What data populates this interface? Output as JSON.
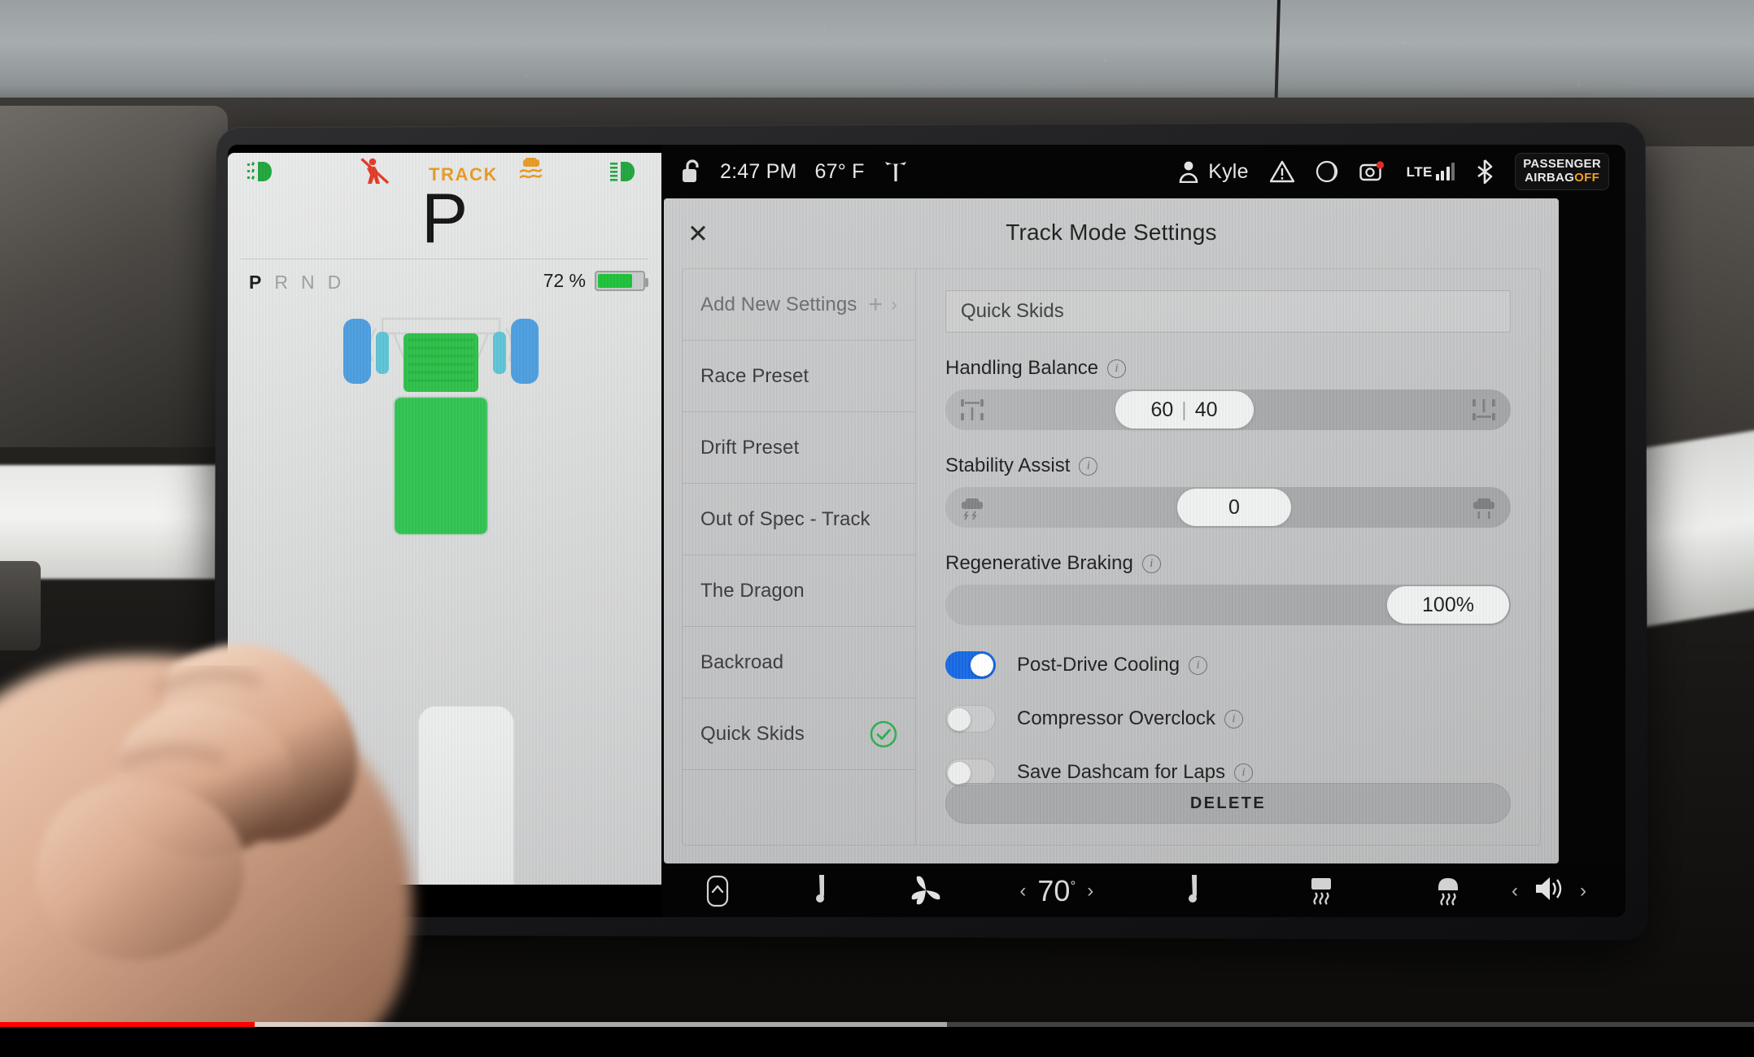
{
  "cluster": {
    "telltales": [
      {
        "name": "low-beam-headlight",
        "symbol": "≢D",
        "color": "#21a63e"
      },
      {
        "name": "seatbelt-warning",
        "color": "#e23b28"
      },
      {
        "name": "track-mode",
        "label": "TRACK",
        "color": "#e89a24"
      },
      {
        "name": "traction-slip",
        "color": "#e89a24"
      },
      {
        "name": "high-beam-headlight",
        "symbol": "≣D",
        "color": "#21a63e"
      }
    ],
    "gear": "P",
    "gear_options": [
      "P",
      "R",
      "N",
      "D"
    ],
    "battery_percent": "72 %",
    "battery_fill_pct": 72
  },
  "statusbar": {
    "lock_icon": "unlocked-icon",
    "time": "2:47 PM",
    "temperature": "67° F",
    "brand_icon": "tesla-logo-icon",
    "profile_name": "Kyle",
    "warning_icon": "warning-triangle-icon",
    "camera_icon": "dashcam-icon",
    "network_label": "LTE",
    "signal_bars": 3,
    "bluetooth_icon": "bluetooth-icon",
    "airbag_line1": "PASSENGER",
    "airbag_line2": "AIRBAG",
    "airbag_state": "OFF",
    "airbag_state_color": "#f0a21e"
  },
  "modal": {
    "title": "Track Mode Settings",
    "close_label": "✕",
    "presets": [
      {
        "label": "Add New Settings",
        "type": "add",
        "muted": true,
        "selected": false
      },
      {
        "label": "Race Preset",
        "type": "preset",
        "muted": false,
        "selected": false
      },
      {
        "label": "Drift Preset",
        "type": "preset",
        "muted": false,
        "selected": false
      },
      {
        "label": "Out of Spec - Track",
        "type": "preset",
        "muted": false,
        "selected": false
      },
      {
        "label": "The Dragon",
        "type": "preset",
        "muted": false,
        "selected": false
      },
      {
        "label": "Backroad",
        "type": "preset",
        "muted": false,
        "selected": false
      },
      {
        "label": "Quick Skids",
        "type": "preset",
        "muted": false,
        "selected": true
      }
    ],
    "preset_name_value": "Quick Skids",
    "preset_name_placeholder": "Quick Skids",
    "handling_balance": {
      "label": "Handling Balance",
      "front": "60",
      "separator": "|",
      "rear": "40",
      "thumb_pct": 30,
      "left_icon": "axle-front-bias-icon",
      "right_icon": "axle-rear-bias-icon"
    },
    "stability_assist": {
      "label": "Stability Assist",
      "value": "0",
      "thumb_pct": 41,
      "left_icon": "car-skid-assist-icon",
      "right_icon": "car-stable-icon"
    },
    "regenerative_braking": {
      "label": "Regenerative Braking",
      "value": "100%",
      "thumb_pct": 82
    },
    "toggles": [
      {
        "label": "Post-Drive Cooling",
        "on": true
      },
      {
        "label": "Compressor Overclock",
        "on": false
      },
      {
        "label": "Save Dashcam for Laps",
        "on": false
      }
    ],
    "toggle_on_color": "#1668e3",
    "delete_label": "DELETE"
  },
  "bottombar": {
    "items": [
      {
        "name": "frunk-open-button",
        "icon": "chevron-up-box-icon"
      },
      {
        "name": "driver-seat-heater-button",
        "icon": "seat-heater-icon"
      },
      {
        "name": "fan-button",
        "icon": "fan-icon"
      },
      {
        "name": "temperature-control",
        "icon": "temperature-stepper"
      },
      {
        "name": "passenger-seat-heater-button",
        "icon": "seat-heater-icon"
      },
      {
        "name": "rear-defrost-button",
        "icon": "rear-defrost-icon"
      },
      {
        "name": "front-defrost-button",
        "icon": "front-defrost-icon"
      },
      {
        "name": "volume-control",
        "icon": "volume-stepper"
      }
    ],
    "temperature": "70",
    "temperature_degree": "°",
    "prev_arrow": "‹",
    "next_arrow": "›"
  },
  "video_overlay": {
    "played_pct": 14.5,
    "buffered_pct": 54,
    "accent_color": "#ff0000"
  }
}
